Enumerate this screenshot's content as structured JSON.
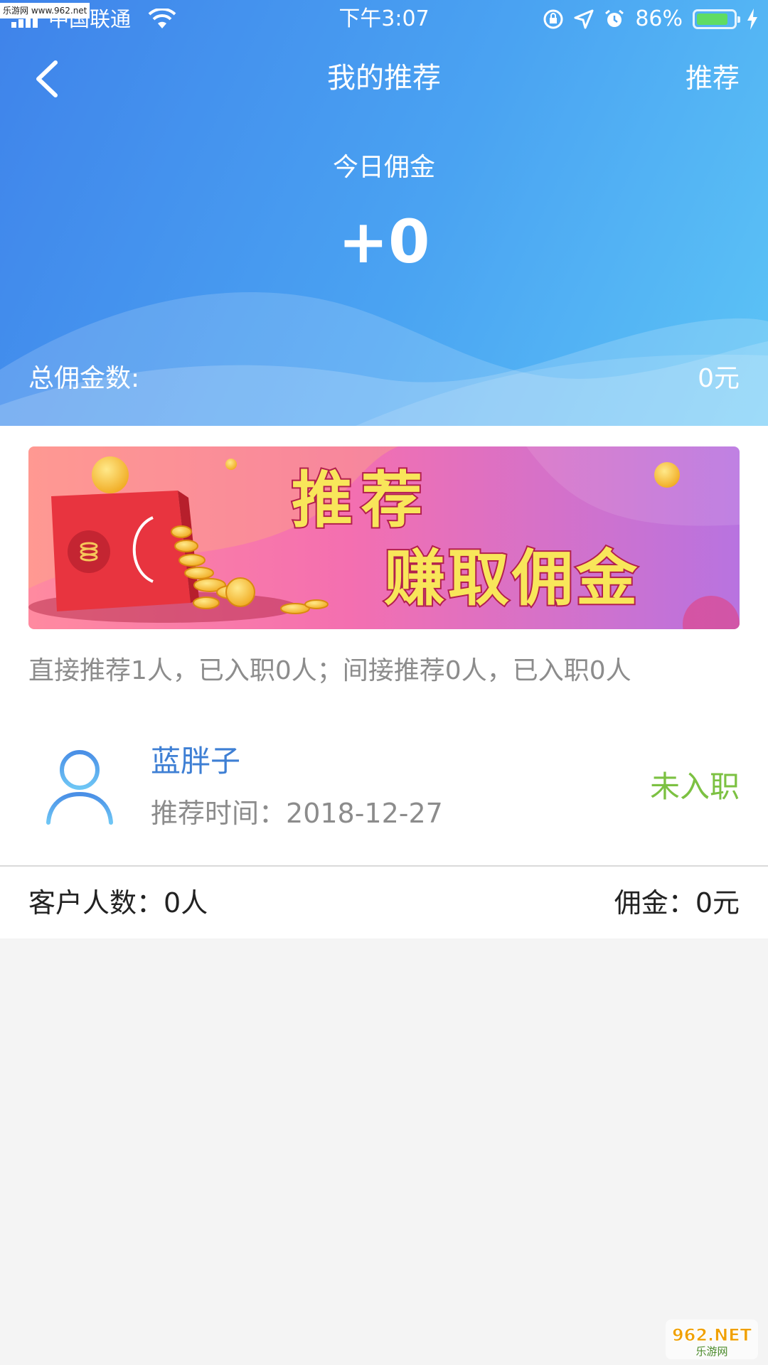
{
  "status_bar": {
    "carrier": "中国联通",
    "time": "下午3:07",
    "battery": "86%",
    "battery_level": 0.86
  },
  "watermarks": {
    "top_left": "乐游网 www.962.net",
    "bottom_right_brand": "962.NET",
    "bottom_right_sub": "乐游网"
  },
  "nav": {
    "title": "我的推荐",
    "action_label": "推荐"
  },
  "today": {
    "label": "今日佣金",
    "value": "+0"
  },
  "total": {
    "label": "总佣金数:",
    "value": "0元"
  },
  "banner": {
    "line1": "推荐",
    "line2": "赚取佣金"
  },
  "summary": "直接推荐1人，已入职0人；间接推荐0人，已入职0人",
  "recommendations": [
    {
      "name": "蓝胖子",
      "time_label": "推荐时间：",
      "time": "2018-12-27",
      "status": "未入职"
    }
  ],
  "stats": {
    "customers_label": "客户人数：",
    "customers_value": "0人",
    "commission_label": "佣金：",
    "commission_value": "0元"
  },
  "colors": {
    "header_start": "#3f83ea",
    "header_end": "#5cc4f6",
    "name_blue": "#3e7fd4",
    "status_green": "#7cc142",
    "muted_text": "#8c8c8c",
    "page_bg": "#f4f4f4"
  }
}
